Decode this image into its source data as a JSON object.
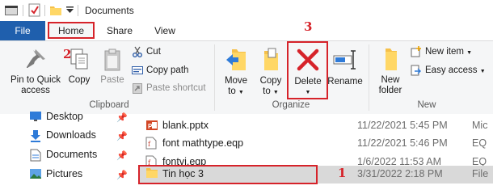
{
  "window": {
    "title": "Documents"
  },
  "tabs": {
    "file": "File",
    "home": "Home",
    "share": "Share",
    "view": "View"
  },
  "ribbon": {
    "clipboard": {
      "pin_line1": "Pin to Quick",
      "pin_line2": "access",
      "copy": "Copy",
      "paste": "Paste",
      "cut": "Cut",
      "copy_path": "Copy path",
      "paste_shortcut": "Paste shortcut",
      "group": "Clipboard"
    },
    "organize": {
      "move_line1": "Move",
      "move_line2": "to",
      "copy_line1": "Copy",
      "copy_line2": "to",
      "delete": "Delete",
      "rename": "Rename",
      "group": "Organize"
    },
    "new": {
      "new_folder_line1": "New",
      "new_folder_line2": "folder",
      "new_item": "New item",
      "easy_access": "Easy access",
      "group": "New"
    }
  },
  "annotations": {
    "one": "1",
    "two": "2",
    "three": "3"
  },
  "nav": [
    "Desktop",
    "Downloads",
    "Documents",
    "Pictures"
  ],
  "files": [
    {
      "name": "blank.pptx",
      "date": "11/22/2021 5:45 PM",
      "type": "Mic"
    },
    {
      "name": "font mathtype.eqp",
      "date": "11/22/2021 5:46 PM",
      "type": "EQ"
    },
    {
      "name": "fontvj.eqp",
      "date": "1/6/2022 11:53 AM",
      "type": "EQ"
    },
    {
      "name": "Tin học 3",
      "date": "3/31/2022 2:18 PM",
      "type": "File"
    }
  ],
  "colors": {
    "file_tab": "#1f5fad",
    "highlight": "#d6232a",
    "selection": "#d9d9d9"
  }
}
